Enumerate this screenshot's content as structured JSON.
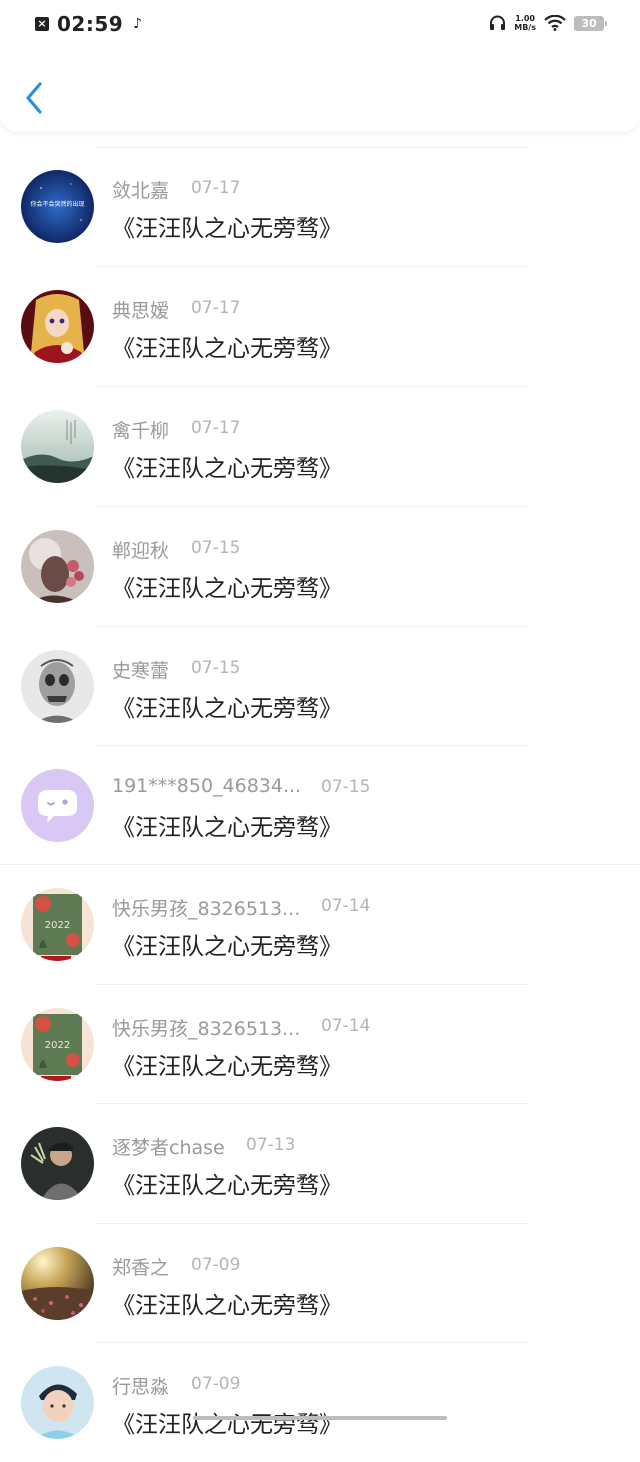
{
  "status_bar": {
    "time": "02:59",
    "speed_value": "1.00",
    "speed_unit": "MB/s",
    "battery": "30",
    "icons": [
      "notification-x-icon",
      "music-note-icon",
      "headphones-icon",
      "wifi-icon",
      "battery-icon"
    ]
  },
  "header": {
    "back_icon": "chevron-left-icon",
    "accent": "#2a8fe0"
  },
  "items": [
    {
      "name": "敛北嘉",
      "date": "07-17",
      "title": "《汪汪队之心无旁骛》",
      "avatar_text": "你会不会突然的出现"
    },
    {
      "name": "典思嫒",
      "date": "07-17",
      "title": "《汪汪队之心无旁骛》"
    },
    {
      "name": "禽千柳",
      "date": "07-17",
      "title": "《汪汪队之心无旁骛》"
    },
    {
      "name": "郸迎秋",
      "date": "07-15",
      "title": "《汪汪队之心无旁骛》"
    },
    {
      "name": "史寒蕾",
      "date": "07-15",
      "title": "《汪汪队之心无旁骛》"
    },
    {
      "name": "191***850_46834...",
      "date": "07-15",
      "title": "《汪汪队之心无旁骛》"
    },
    {
      "name": "快乐男孩_8326513...",
      "date": "07-14",
      "title": "《汪汪队之心无旁骛》",
      "avatar_text": "2022"
    },
    {
      "name": "快乐男孩_8326513...",
      "date": "07-14",
      "title": "《汪汪队之心无旁骛》",
      "avatar_text": "2022"
    },
    {
      "name": "逐梦者chase",
      "date": "07-13",
      "title": "《汪汪队之心无旁骛》"
    },
    {
      "name": "郑香之",
      "date": "07-09",
      "title": "《汪汪队之心无旁骛》"
    },
    {
      "name": "行思淼",
      "date": "07-09",
      "title": "《汪汪队之心无旁骛》"
    }
  ]
}
